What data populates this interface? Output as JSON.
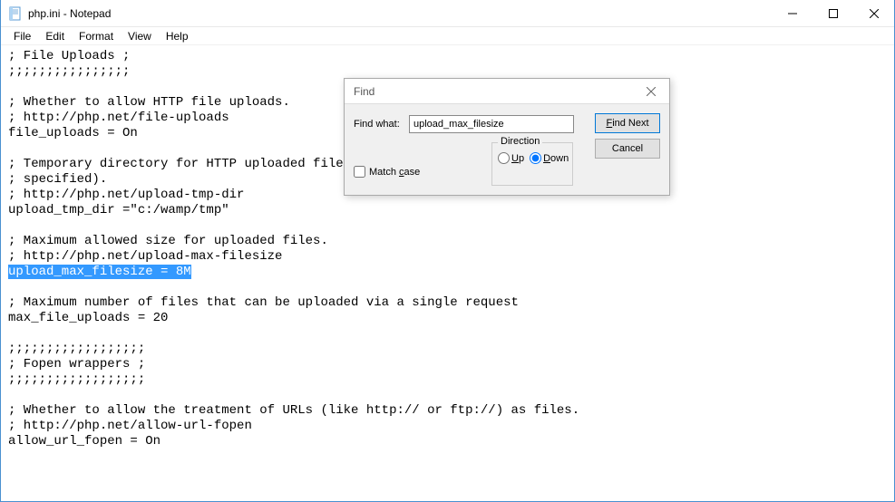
{
  "window": {
    "title": "php.ini - Notepad"
  },
  "menubar": {
    "items": [
      "File",
      "Edit",
      "Format",
      "View",
      "Help"
    ]
  },
  "editor": {
    "lines": [
      "; File Uploads ;",
      ";;;;;;;;;;;;;;;;",
      "",
      "; Whether to allow HTTP file uploads.",
      "; http://php.net/file-uploads",
      "file_uploads = On",
      "",
      "; Temporary directory for HTTP uploaded files (will use system default if not",
      "; specified).",
      "; http://php.net/upload-tmp-dir",
      "upload_tmp_dir =\"c:/wamp/tmp\"",
      "",
      "; Maximum allowed size for uploaded files.",
      "; http://php.net/upload-max-filesize",
      "upload_max_filesize = 8M",
      "",
      "; Maximum number of files that can be uploaded via a single request",
      "max_file_uploads = 20",
      "",
      ";;;;;;;;;;;;;;;;;;",
      "; Fopen wrappers ;",
      ";;;;;;;;;;;;;;;;;;",
      "",
      "; Whether to allow the treatment of URLs (like http:// or ftp://) as files.",
      "; http://php.net/allow-url-fopen",
      "allow_url_fopen = On"
    ],
    "highlighted_line_index": 14
  },
  "find_dialog": {
    "title": "Find",
    "find_what_label": "Find what:",
    "find_what_value": "upload_max_filesize",
    "find_next_label": "Find Next",
    "cancel_label": "Cancel",
    "match_case_label": "Match case",
    "direction_label": "Direction",
    "up_label": "Up",
    "down_label": "Down",
    "direction_selected": "down"
  }
}
